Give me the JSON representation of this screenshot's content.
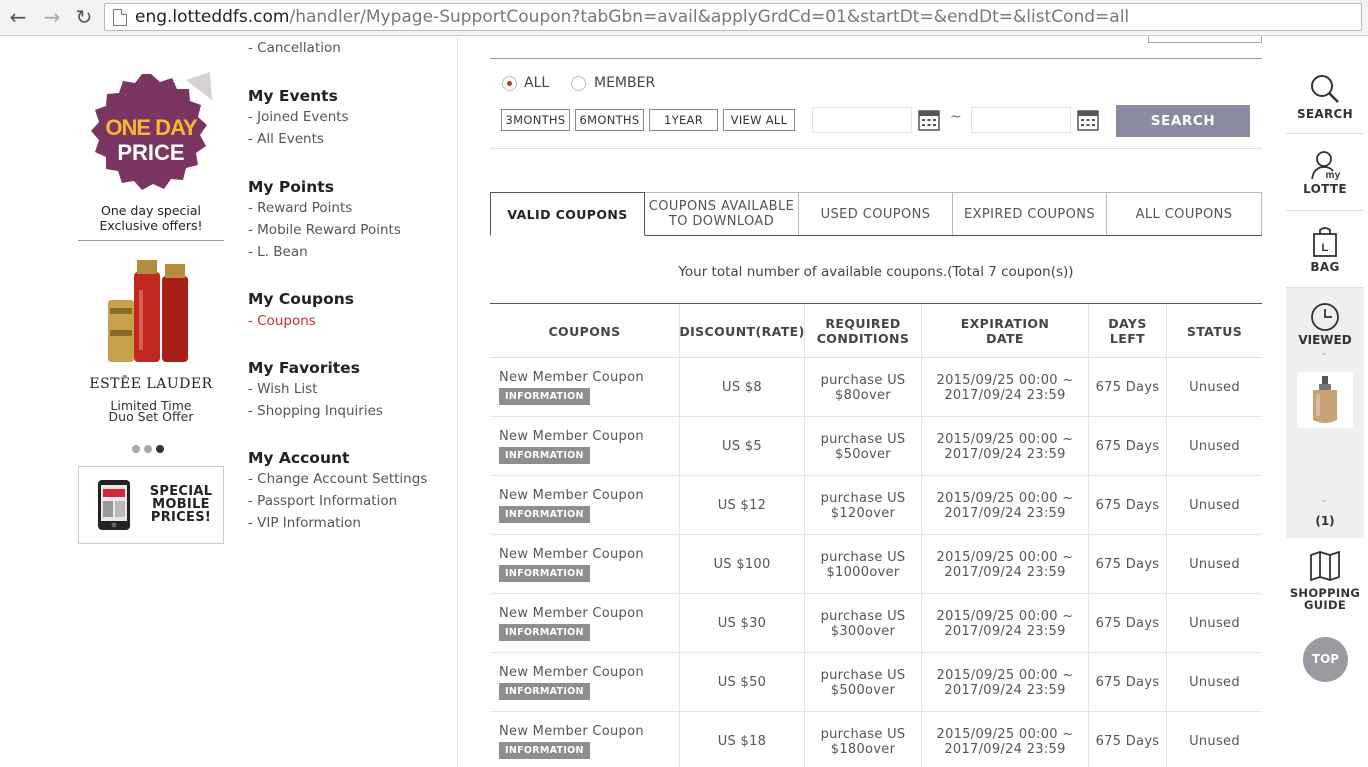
{
  "browser": {
    "url_domain": "eng.lotteddfs.com",
    "url_path": "/handler/Mypage-SupportCoupon?tabGbn=avail&applyGrdCd=01&startDt=&endDt=&listCond=all"
  },
  "promo": {
    "badge_line1": "ONE DAY",
    "badge_line2": "PRICE",
    "caption_line1": "One day special",
    "caption_line2": "Exclusive offers!",
    "brand": "ESTĒE LAUDER",
    "offer_line1": "Limited Time",
    "offer_line2": "Duo Set Offer",
    "mobile_line1": "SPECIAL",
    "mobile_line2": "MOBILE",
    "mobile_line3": "PRICES!"
  },
  "menu": {
    "cancellation": "- Cancellation",
    "events_title": "My Events",
    "events_items": [
      "- Joined Events",
      "- All Events"
    ],
    "points_title": "My Points",
    "points_items": [
      "- Reward Points",
      "- Mobile Reward Points",
      "- L. Bean"
    ],
    "coupons_title": "My Coupons",
    "coupons_items": [
      "- Coupons"
    ],
    "favorites_title": "My Favorites",
    "favorites_items": [
      "- Wish List",
      "- Shopping Inquiries"
    ],
    "account_title": "My Account",
    "account_items": [
      "- Change Account Settings",
      "- Passport Information",
      "- VIP Information"
    ]
  },
  "filters": {
    "radio_all": "ALL",
    "radio_member": "MEMBER",
    "periods": [
      "3MONTHS",
      "6MONTHS",
      "1YEAR",
      "VIEW ALL"
    ],
    "tilde": "~",
    "search": "SEARCH"
  },
  "tabs": {
    "valid": "VALID COUPONS",
    "download_line1": "COUPONS AVAILABLE",
    "download_line2": "TO DOWNLOAD",
    "used": "USED COUPONS",
    "expired": "EXPIRED COUPONS",
    "all": "ALL COUPONS"
  },
  "total_text": "Your total number of available coupons.(Total 7 coupon(s))",
  "table": {
    "headers": {
      "coupons": "COUPONS",
      "discount": "DISCOUNT(RATE)",
      "required_line1": "REQUIRED",
      "required_line2": "CONDITIONS",
      "expiration_line1": "EXPIRATION",
      "expiration_line2": "DATE",
      "days_line1": "DAYS",
      "days_line2": "LEFT",
      "status": "STATUS"
    },
    "info_label": "INFORMATION",
    "rows": [
      {
        "name": "New Member Coupon",
        "discount": "US $8",
        "cond_line1": "purchase US",
        "cond_line2": "$80over",
        "exp_line1": "2015/09/25 00:00 ~",
        "exp_line2": "2017/09/24 23:59",
        "days": "675 Days",
        "status": "Unused"
      },
      {
        "name": "New Member Coupon",
        "discount": "US $5",
        "cond_line1": "purchase US",
        "cond_line2": "$50over",
        "exp_line1": "2015/09/25 00:00 ~",
        "exp_line2": "2017/09/24 23:59",
        "days": "675 Days",
        "status": "Unused"
      },
      {
        "name": "New Member Coupon",
        "discount": "US $12",
        "cond_line1": "purchase US",
        "cond_line2": "$120over",
        "exp_line1": "2015/09/25 00:00 ~",
        "exp_line2": "2017/09/24 23:59",
        "days": "675 Days",
        "status": "Unused"
      },
      {
        "name": "New Member Coupon",
        "discount": "US $100",
        "cond_line1": "purchase US",
        "cond_line2": "$1000over",
        "exp_line1": "2015/09/25 00:00 ~",
        "exp_line2": "2017/09/24 23:59",
        "days": "675 Days",
        "status": "Unused"
      },
      {
        "name": "New Member Coupon",
        "discount": "US $30",
        "cond_line1": "purchase US",
        "cond_line2": "$300over",
        "exp_line1": "2015/09/25 00:00 ~",
        "exp_line2": "2017/09/24 23:59",
        "days": "675 Days",
        "status": "Unused"
      },
      {
        "name": "New Member Coupon",
        "discount": "US $50",
        "cond_line1": "purchase US",
        "cond_line2": "$500over",
        "exp_line1": "2015/09/25 00:00 ~",
        "exp_line2": "2017/09/24 23:59",
        "days": "675 Days",
        "status": "Unused"
      },
      {
        "name": "New Member Coupon",
        "discount": "US $18",
        "cond_line1": "purchase US",
        "cond_line2": "$180over",
        "exp_line1": "2015/09/25 00:00 ~",
        "exp_line2": "2017/09/24 23:59",
        "days": "675 Days",
        "status": "Unused"
      }
    ]
  },
  "sidebar": {
    "search": "SEARCH",
    "my_small": "my",
    "lotte": "LOTTE",
    "bag": "BAG",
    "bag_letter": "L",
    "viewed": "VIEWED",
    "viewed_count": "(1)",
    "guide_line1": "SHOPPING",
    "guide_line2": "GUIDE",
    "top": "TOP"
  },
  "colors": {
    "accent_red": "#d2283a",
    "search_button": "#8a8ba0",
    "badge_purple": "#7a3560",
    "badge_yellow": "#f7b733"
  }
}
